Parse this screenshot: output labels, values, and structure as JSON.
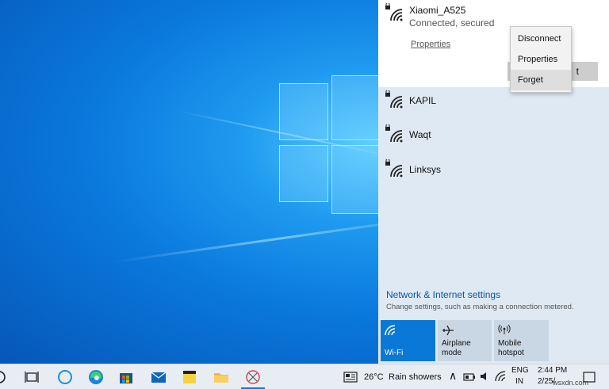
{
  "flyout": {
    "connected": {
      "name": "Xiaomi_A525",
      "status": "Connected, secured",
      "properties_link": "Properties",
      "hidden_button_label": "t"
    },
    "context_menu": [
      "Disconnect",
      "Properties",
      "Forget"
    ],
    "networks": [
      {
        "name": "KAPIL"
      },
      {
        "name": "Waqt"
      },
      {
        "name": "Linksys"
      }
    ],
    "settings_title": "Network & Internet settings",
    "settings_subtitle": "Change settings, such as making a connection metered.",
    "tiles": [
      {
        "label": "Wi-Fi",
        "icon": "wifi-icon",
        "active": true
      },
      {
        "label": "Airplane mode",
        "icon": "airplane-icon",
        "active": false
      },
      {
        "label1": "Mobile",
        "label2": "hotspot",
        "icon": "hotspot-icon",
        "active": false
      }
    ]
  },
  "taskbar": {
    "apps": [
      "cortana-icon",
      "task-view-icon",
      "edge-icon",
      "store-icon",
      "mail-icon",
      "sticky-notes-icon",
      "file-explorer-icon",
      "snipping-tool-icon"
    ],
    "weather_temp": "26°C",
    "weather_desc": "Rain showers",
    "lang1": "ENG",
    "lang2": "IN",
    "time": "2:44 PM",
    "date": "2/25/"
  },
  "watermark": "wsxdn.com",
  "colors": {
    "accent": "#0a78d7",
    "link": "#0a56a8",
    "flyout_bg": "#dfe9f3"
  }
}
